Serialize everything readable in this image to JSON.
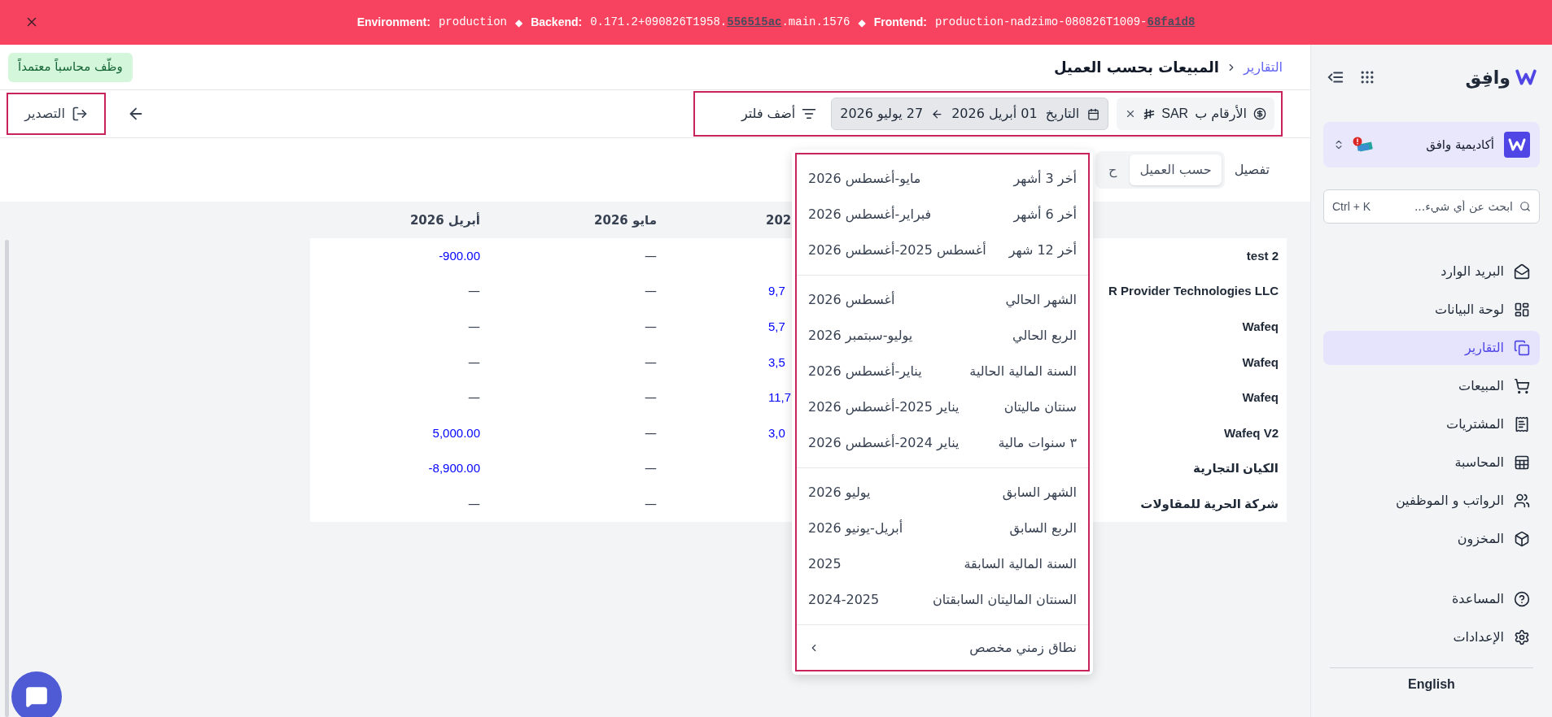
{
  "banner": {
    "separator": "◆",
    "environment": {
      "label": "Environment:",
      "value": "production"
    },
    "backend": {
      "label": "Backend:",
      "value": "0.171.2+090826T1958.",
      "link": "556515ac",
      "suffix": ".main.1576"
    },
    "frontend": {
      "label": "Frontend:",
      "value": "production-nadzimo-080826T1009-",
      "link": "68fa1d8"
    }
  },
  "sidebar": {
    "logo": "وافِق",
    "organization": "أكاديمية وافق",
    "search": {
      "placeholder": "ابحث عن أي شيء...",
      "shortcut": "Ctrl + K"
    },
    "items": [
      {
        "label": "البريد الوارد",
        "selected": false
      },
      {
        "label": "لوحة البيانات",
        "selected": false
      },
      {
        "label": "التقارير",
        "selected": true
      },
      {
        "label": "المبيعات",
        "selected": false
      },
      {
        "label": "المشتريات",
        "selected": false
      },
      {
        "label": "المحاسبة",
        "selected": false
      },
      {
        "label": "الرواتب و الموظفين",
        "selected": false
      },
      {
        "label": "المخزون",
        "selected": false
      }
    ],
    "footer_items": [
      {
        "label": "المساعدة"
      },
      {
        "label": "الإعدادات"
      }
    ],
    "language": "English"
  },
  "header": {
    "breadcrumb": "التقارير",
    "title": "المبيعات بحسب العميل",
    "promo": "وظّف محاسباً معتمداً"
  },
  "filters": {
    "currency": {
      "label": "الأرقام ب",
      "value": "SAR"
    },
    "date": {
      "label": "التاريخ",
      "from": "01 أبريل 2026",
      "to": "27 يوليو 2026"
    },
    "add_filter": "أضف فلتر"
  },
  "export": "التصدير",
  "view": {
    "label": "تفصيل",
    "tabs": [
      {
        "label": "حسب العميل",
        "selected": true
      },
      {
        "label": "ح",
        "selected": false
      }
    ]
  },
  "table": {
    "columns": [
      "202",
      "مايو 2026",
      "أبريل 2026"
    ],
    "rows": [
      {
        "name": "test 2",
        "cells": [
          null,
          {
            "text": "—",
            "kind": "empty"
          },
          {
            "text": "-900.00",
            "kind": "amount"
          }
        ]
      },
      {
        "name": "R Provider Technologies LLC",
        "cells": [
          {
            "text": "9,7",
            "kind": "amount"
          },
          {
            "text": "—",
            "kind": "empty"
          },
          {
            "text": "—",
            "kind": "empty"
          }
        ]
      },
      {
        "name": "Wafeq",
        "cells": [
          {
            "text": "5,7",
            "kind": "amount"
          },
          {
            "text": "—",
            "kind": "empty"
          },
          {
            "text": "—",
            "kind": "empty"
          }
        ]
      },
      {
        "name": "Wafeq",
        "cells": [
          {
            "text": "3,5",
            "kind": "amount"
          },
          {
            "text": "—",
            "kind": "empty"
          },
          {
            "text": "—",
            "kind": "empty"
          }
        ]
      },
      {
        "name": "Wafeq",
        "cells": [
          {
            "text": "11,7",
            "kind": "amount"
          },
          {
            "text": "—",
            "kind": "empty"
          },
          {
            "text": "—",
            "kind": "empty"
          }
        ]
      },
      {
        "name": "Wafeq V2",
        "cells": [
          {
            "text": "3,0",
            "kind": "amount"
          },
          {
            "text": "—",
            "kind": "empty"
          },
          {
            "text": "5,000.00",
            "kind": "amount"
          }
        ]
      },
      {
        "name": "الكيان التجارية",
        "cells": [
          null,
          {
            "text": "—",
            "kind": "empty"
          },
          {
            "text": "-8,900.00",
            "kind": "amount"
          }
        ]
      },
      {
        "name": "شركة الحرية للمقاولات",
        "cells": [
          null,
          {
            "text": "—",
            "kind": "empty"
          },
          {
            "text": "—",
            "kind": "empty"
          }
        ]
      }
    ]
  },
  "date_presets": {
    "groups": [
      [
        {
          "label": "أخر 3 أشهر",
          "range": "مايو-أغسطس 2026"
        },
        {
          "label": "أخر 6 أشهر",
          "range": "فبراير-أغسطس 2026"
        },
        {
          "label": "أخر 12 شهر",
          "range": "أغسطس 2025-أغسطس 2026"
        }
      ],
      [
        {
          "label": "الشهر الحالي",
          "range": "أغسطس 2026"
        },
        {
          "label": "الربع الحالي",
          "range": "يوليو-سبتمبر 2026"
        },
        {
          "label": "السنة المالية الحالية",
          "range": "يناير-أغسطس 2026"
        },
        {
          "label": "سنتان ماليتان",
          "range": "يناير 2025-أغسطس 2026"
        },
        {
          "label": "٣ سنوات مالية",
          "range": "يناير 2024-أغسطس 2026"
        }
      ],
      [
        {
          "label": "الشهر السابق",
          "range": "يوليو 2026"
        },
        {
          "label": "الربع السابق",
          "range": "أبريل-يونيو 2026"
        },
        {
          "label": "السنة المالية السابقة",
          "range": "2025"
        },
        {
          "label": "السنتان الماليتان السابقتان",
          "range": "2024-2025"
        }
      ]
    ],
    "custom": "نطاق زمني مخصص"
  }
}
